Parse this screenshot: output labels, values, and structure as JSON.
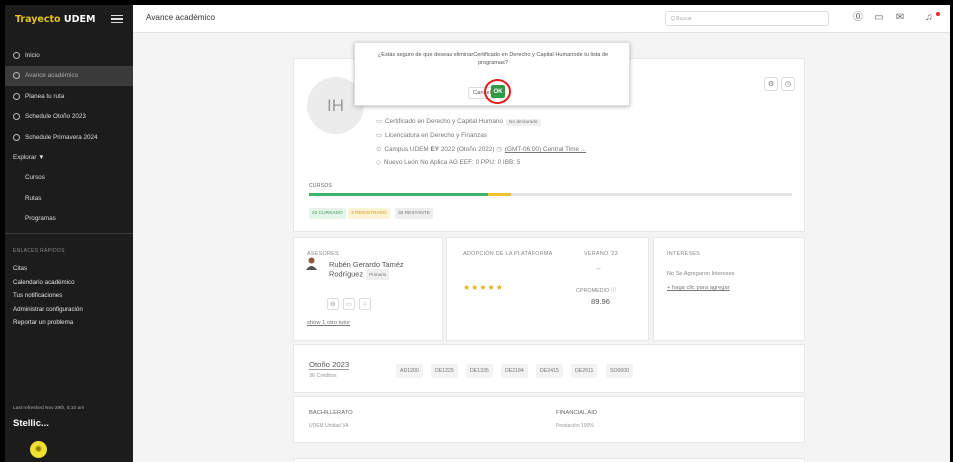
{
  "sidebar": {
    "logo_part1": "Trayecto",
    "logo_part2": "UDEM",
    "nav_items": [
      {
        "label": "Inicio",
        "icon": "home-icon"
      },
      {
        "label": "Avance académico",
        "icon": "check-circle-icon"
      },
      {
        "label": "Planea tu ruta",
        "icon": "route-icon"
      },
      {
        "label": "Schedule Otoño 2023",
        "icon": "calendar-icon"
      },
      {
        "label": "Schedule Primavera 2024",
        "icon": "calendar-icon"
      }
    ],
    "explore_label": "Explorar ▼",
    "explore_items": [
      "Cursos",
      "Rutas",
      "Programas"
    ],
    "quick_links_title": "ENLACES RÁPIDOS",
    "quick_links": [
      "Citas",
      "Calendario académico",
      "Tus notificaciones",
      "Administrar configuración",
      "Reportar un problema"
    ],
    "refresh_text": "Last refreshed Nov 29th, 5:10 am",
    "brand": "Stellic..."
  },
  "header": {
    "title": "Avance académico",
    "search_placeholder": "Q Buscar"
  },
  "dialog": {
    "message": "¿Estás seguro de que deseas eliminarCertificado en Derecho y Capital Humanode tu lista de programas?",
    "cancel_label": "Cancel",
    "ok_label": "OK"
  },
  "profile": {
    "initials": "IH",
    "program1": "Certificado en Derecho y Capital Humano",
    "program1_badge": "No declarado",
    "program2": "Licenciatura en Derecho y Finanzas",
    "campus_line": "Campus UDEM",
    "ey_label": "EY",
    "ey_value": "2022 (Otoño 2022)",
    "timezone": "(GMT-06:00) Central Time ...",
    "tags": "Nuevo León   No Aplica AG   EEF: 0   PPU: 0   IBB: 5",
    "cursos_label": "CURSOS",
    "progress": {
      "cursado": 23,
      "registrado": 3,
      "restante": 36
    },
    "chips": [
      "23 CURSADO",
      "3 REGISTRADO",
      "36 RESTANTE"
    ]
  },
  "asesores": {
    "title": "ASESORES",
    "name": "Rubén Gerardo Taméz Rodríguez",
    "role": "Primario",
    "show_tutor": "show 1 otro tutor"
  },
  "adopcion": {
    "title": "ADOPCIÓN DE LA PLATAFORMA",
    "stars": "★★★★★",
    "rating": 5,
    "term_label": "VERANO '23",
    "dash": "--",
    "promedio_label": "CPROMEDIO ⓘ",
    "promedio_value": "89.96"
  },
  "intereses": {
    "title": "INTERESES",
    "text": "No Se Agregaron Intereses",
    "link": "+ haga clic para agregar"
  },
  "term": {
    "name": "Otoño 2023",
    "credits": "36 Créditos",
    "courses": [
      "AD1200",
      "DE1225",
      "DE1335",
      "DE2184",
      "DE2415",
      "DE2611",
      "SO0000"
    ]
  },
  "bachillerato": {
    "title": "BACHILLERATO",
    "value": "UDEM Unidad VA"
  },
  "financial": {
    "title": "FINANCIAL AID",
    "value": "Prestación 100%"
  },
  "colors": {
    "accent_green": "#2f9a44",
    "bar_green": "#3fb56b",
    "bar_yellow": "#f2c12e",
    "highlight_red": "#e01b1b",
    "sidebar_bg": "#1c1c1c"
  }
}
